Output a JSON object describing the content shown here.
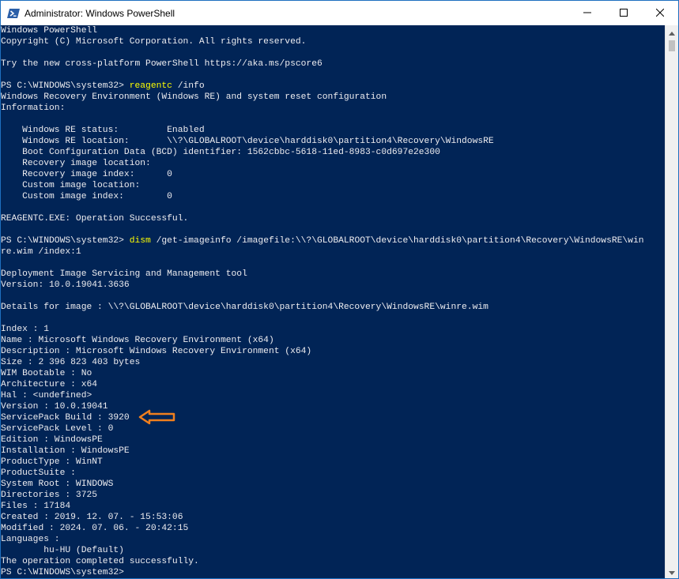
{
  "window": {
    "title": "Administrator: Windows PowerShell",
    "icon": "powershell-icon",
    "buttons": [
      "minimize-icon",
      "maximize-icon",
      "close-icon"
    ],
    "colors": {
      "console_background": "#012456",
      "console_text": "#eeedf0",
      "command_text": "#ffff00",
      "annotation_arrow": "#f07f1e"
    }
  },
  "console": {
    "lines": [
      {
        "text": "Windows PowerShell"
      },
      {
        "text": "Copyright (C) Microsoft Corporation. All rights reserved."
      },
      {
        "text": ""
      },
      {
        "text": "Try the new cross-platform PowerShell https://aka.ms/pscore6"
      },
      {
        "text": ""
      },
      {
        "prompt": "PS C:\\WINDOWS\\system32> ",
        "command": "reagentc",
        "args": " /info"
      },
      {
        "text": "Windows Recovery Environment (Windows RE) and system reset configuration"
      },
      {
        "text": "Information:"
      },
      {
        "text": ""
      },
      {
        "text": "    Windows RE status:         Enabled"
      },
      {
        "text": "    Windows RE location:       \\\\?\\GLOBALROOT\\device\\harddisk0\\partition4\\Recovery\\WindowsRE"
      },
      {
        "text": "    Boot Configuration Data (BCD) identifier: 1562cbbc-5618-11ed-8983-c0d697e2e300"
      },
      {
        "text": "    Recovery image location:"
      },
      {
        "text": "    Recovery image index:      0"
      },
      {
        "text": "    Custom image location:"
      },
      {
        "text": "    Custom image index:        0"
      },
      {
        "text": ""
      },
      {
        "text": "REAGENTC.EXE: Operation Successful."
      },
      {
        "text": ""
      },
      {
        "prompt": "PS C:\\WINDOWS\\system32> ",
        "command": "dism",
        "args": " /get-imageinfo /imagefile:\\\\?\\GLOBALROOT\\device\\harddisk0\\partition4\\Recovery\\WindowsRE\\win"
      },
      {
        "text": "re.wim /index:1"
      },
      {
        "text": ""
      },
      {
        "text": "Deployment Image Servicing and Management tool"
      },
      {
        "text": "Version: 10.0.19041.3636"
      },
      {
        "text": ""
      },
      {
        "text": "Details for image : \\\\?\\GLOBALROOT\\device\\harddisk0\\partition4\\Recovery\\WindowsRE\\winre.wim"
      },
      {
        "text": ""
      },
      {
        "text": "Index : 1"
      },
      {
        "text": "Name : Microsoft Windows Recovery Environment (x64)"
      },
      {
        "text": "Description : Microsoft Windows Recovery Environment (x64)"
      },
      {
        "text": "Size : 2 396 823 403 bytes"
      },
      {
        "text": "WIM Bootable : No"
      },
      {
        "text": "Architecture : x64"
      },
      {
        "text": "Hal : <undefined>"
      },
      {
        "text": "Version : 10.0.19041"
      },
      {
        "text": "ServicePack Build : 3920"
      },
      {
        "text": "ServicePack Level : 0"
      },
      {
        "text": "Edition : WindowsPE"
      },
      {
        "text": "Installation : WindowsPE"
      },
      {
        "text": "ProductType : WinNT"
      },
      {
        "text": "ProductSuite :"
      },
      {
        "text": "System Root : WINDOWS"
      },
      {
        "text": "Directories : 3725"
      },
      {
        "text": "Files : 17184"
      },
      {
        "text": "Created : 2019. 12. 07. - 15:53:06"
      },
      {
        "text": "Modified : 2024. 07. 06. - 20:42:15"
      },
      {
        "text": "Languages :"
      },
      {
        "text": "        hu-HU (Default)"
      },
      {
        "text": "The operation completed successfully."
      },
      {
        "text": "PS C:\\WINDOWS\\system32>"
      }
    ]
  },
  "scrollbar": {
    "up_icon": "scroll-up-arrow-icon",
    "down_icon": "scroll-down-arrow-icon"
  },
  "annotation": {
    "icon": "orange-arrow-pointing-left-icon"
  }
}
